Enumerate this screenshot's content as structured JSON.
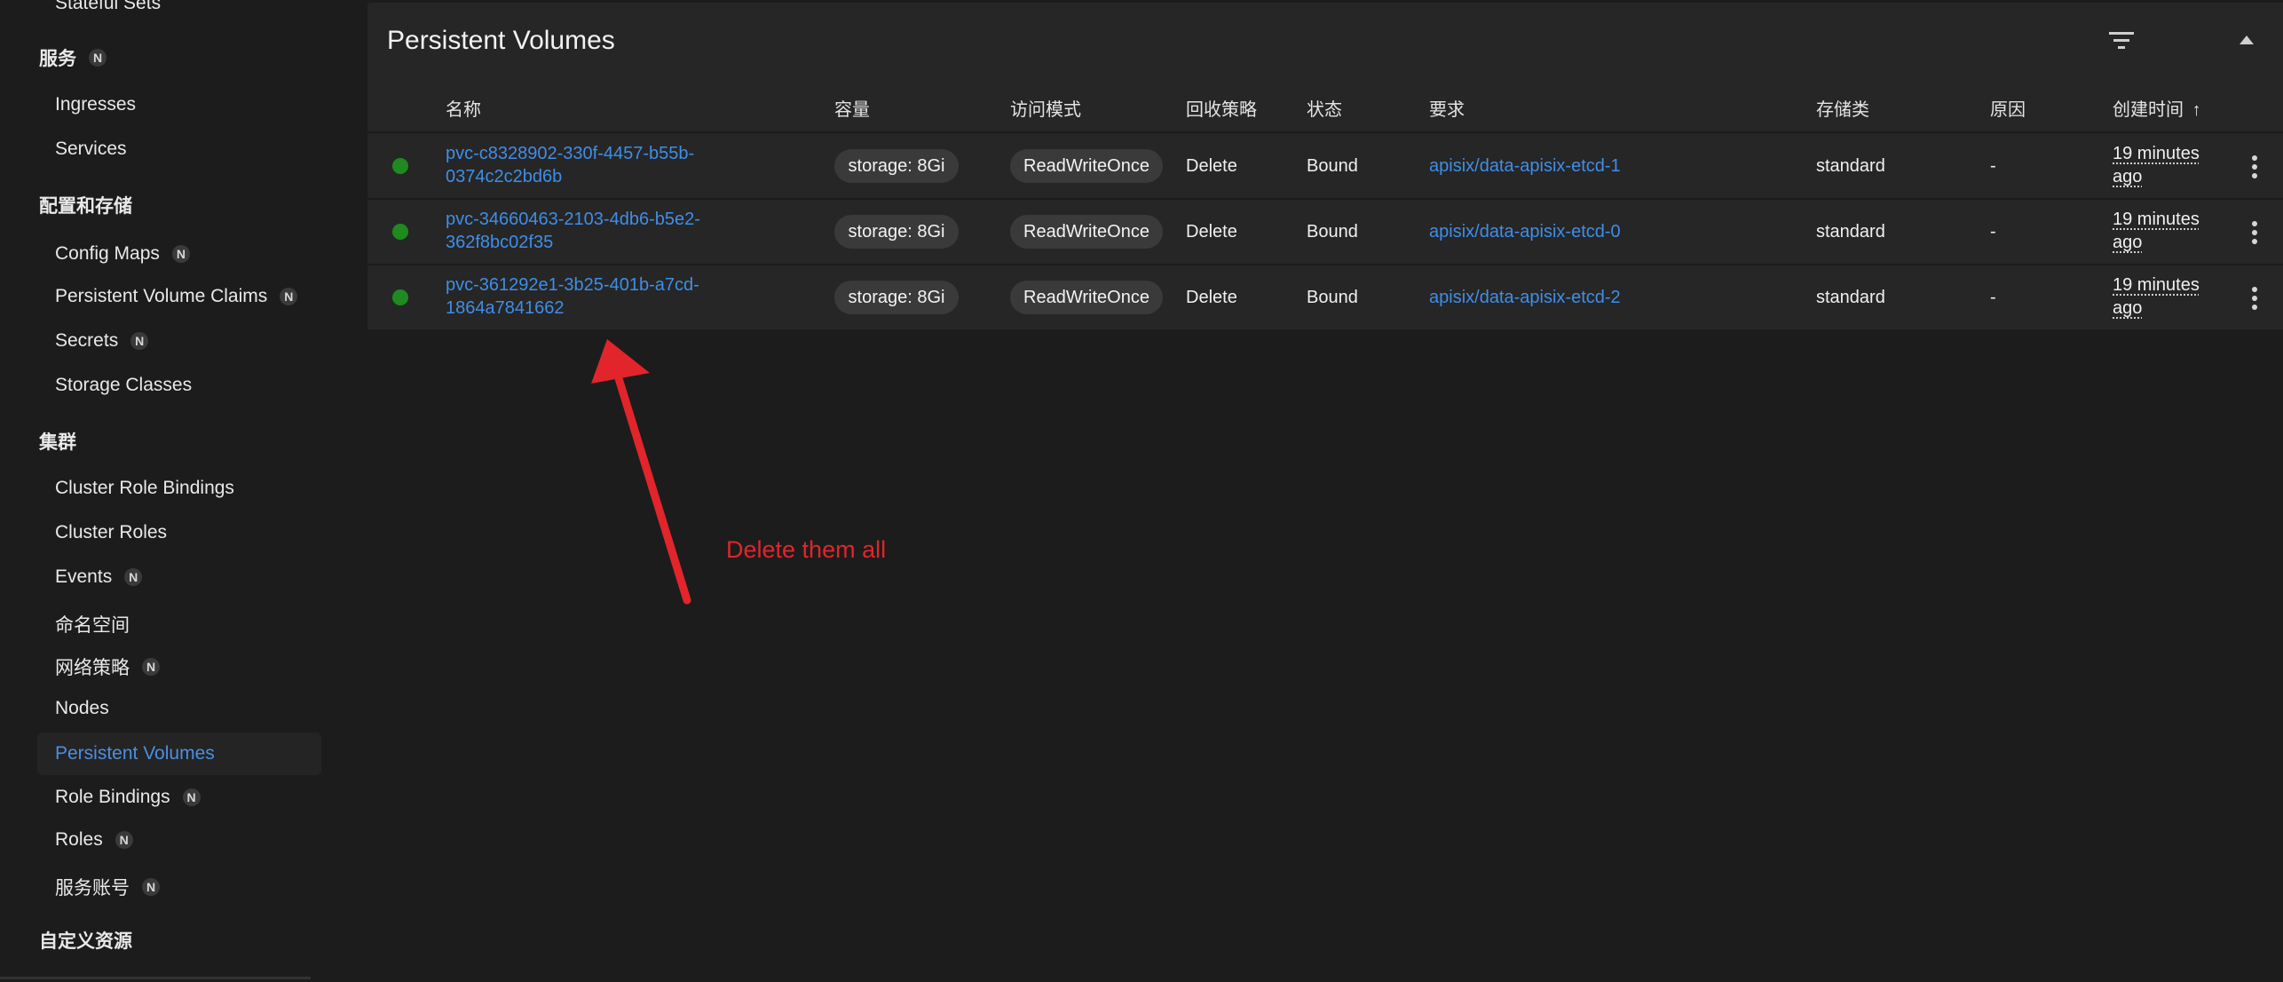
{
  "sidebar": {
    "top_cut_item": "Stateful Sets",
    "badge": "N",
    "sections": [
      {
        "label": "服务",
        "badge": true
      },
      {
        "label": "配置和存储",
        "badge": false
      },
      {
        "label": "集群",
        "badge": false
      },
      {
        "label": "自定义资源",
        "badge": false
      }
    ],
    "items": [
      {
        "label": "Ingresses"
      },
      {
        "label": "Services"
      },
      {
        "label": "Config Maps",
        "badge": true
      },
      {
        "label": "Persistent Volume Claims",
        "badge": true
      },
      {
        "label": "Secrets",
        "badge": true
      },
      {
        "label": "Storage Classes"
      },
      {
        "label": "Cluster Role Bindings"
      },
      {
        "label": "Cluster Roles"
      },
      {
        "label": "Events",
        "badge": true
      },
      {
        "label": "命名空间"
      },
      {
        "label": "网络策略",
        "badge": true
      },
      {
        "label": "Nodes"
      },
      {
        "label": "Persistent Volumes",
        "active": true
      },
      {
        "label": "Role Bindings",
        "badge": true
      },
      {
        "label": "Roles",
        "badge": true
      },
      {
        "label": "服务账号",
        "badge": true
      }
    ]
  },
  "panel": {
    "title": "Persistent Volumes",
    "columns": {
      "name": "名称",
      "capacity": "容量",
      "access_mode": "访问模式",
      "reclaim": "回收策略",
      "status": "状态",
      "claim": "要求",
      "storage_class": "存储类",
      "reason": "原因",
      "created": "创建时间",
      "sort_arrow": "↑"
    },
    "rows": [
      {
        "name": "pvc-c8328902-330f-4457-b55b-0374c2c2bd6b",
        "capacity": "storage: 8Gi",
        "access_mode": "ReadWriteOnce",
        "reclaim": "Delete",
        "status": "Bound",
        "claim": "apisix/data-apisix-etcd-1",
        "storage_class": "standard",
        "reason": "-",
        "created": "19 minutes ago"
      },
      {
        "name": "pvc-34660463-2103-4db6-b5e2-362f8bc02f35",
        "capacity": "storage: 8Gi",
        "access_mode": "ReadWriteOnce",
        "reclaim": "Delete",
        "status": "Bound",
        "claim": "apisix/data-apisix-etcd-0",
        "storage_class": "standard",
        "reason": "-",
        "created": "19 minutes ago"
      },
      {
        "name": "pvc-361292e1-3b25-401b-a7cd-1864a7841662",
        "capacity": "storage: 8Gi",
        "access_mode": "ReadWriteOnce",
        "reclaim": "Delete",
        "status": "Bound",
        "claim": "apisix/data-apisix-etcd-2",
        "storage_class": "standard",
        "reason": "-",
        "created": "19 minutes ago"
      }
    ]
  },
  "annotation": {
    "text": "Delete them all",
    "color": "#e1252b"
  },
  "colors": {
    "link": "#3f8ee8",
    "status_ok": "#1f8a1f",
    "background": "#1c1c1c",
    "panel": "#262626"
  }
}
